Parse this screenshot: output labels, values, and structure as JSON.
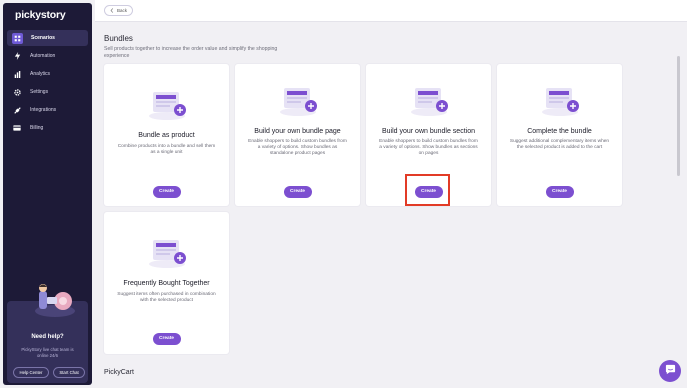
{
  "app": {
    "logo": "pickystory"
  },
  "sidebar": {
    "items": [
      {
        "label": "Scenarios",
        "icon": "scenarios-icon",
        "active": true
      },
      {
        "label": "Automation",
        "icon": "lightning-icon",
        "active": false
      },
      {
        "label": "Analytics",
        "icon": "bar-chart-icon",
        "active": false
      },
      {
        "label": "Settings",
        "icon": "gear-icon",
        "active": false
      },
      {
        "label": "Integrations",
        "icon": "integrations-icon",
        "active": false
      },
      {
        "label": "Billing",
        "icon": "credit-card-icon",
        "active": false
      }
    ],
    "help": {
      "title": "Need help?",
      "text": "PickyStory live chat team is online 24/6",
      "help_center": "Help Center",
      "start_chat": "Start Chat"
    }
  },
  "topbar": {
    "back_label": "Back"
  },
  "section": {
    "title": "Bundles",
    "subtitle": "Sell products together to increase the order value and simplify the shopping experience"
  },
  "cards": [
    {
      "title": "Bundle as product",
      "desc": "Combine products into a bundle and sell them as a single unit",
      "button": "Create"
    },
    {
      "title": "Build your own bundle page",
      "desc": "Enable shoppers to build custom bundles from a variety of options. Show bundles as standalone product pages",
      "button": "Create"
    },
    {
      "title": "Build your own bundle section",
      "desc": "Enable shoppers to build custom bundles from a variety of options. Show bundles as sections on pages",
      "button": "Create"
    },
    {
      "title": "Complete the bundle",
      "desc": "Suggest additional complementary items when the selected product is added to the cart",
      "button": "Create"
    },
    {
      "title": "Frequently Bought Together",
      "desc": "Suggest items often purchased in combination with the selected product",
      "button": "Create"
    }
  ],
  "next_section": {
    "title": "PickyCart"
  },
  "colors": {
    "sidebar_bg": "#1d1a37",
    "accent": "#7c4fd0",
    "highlight": "#e23b26"
  }
}
